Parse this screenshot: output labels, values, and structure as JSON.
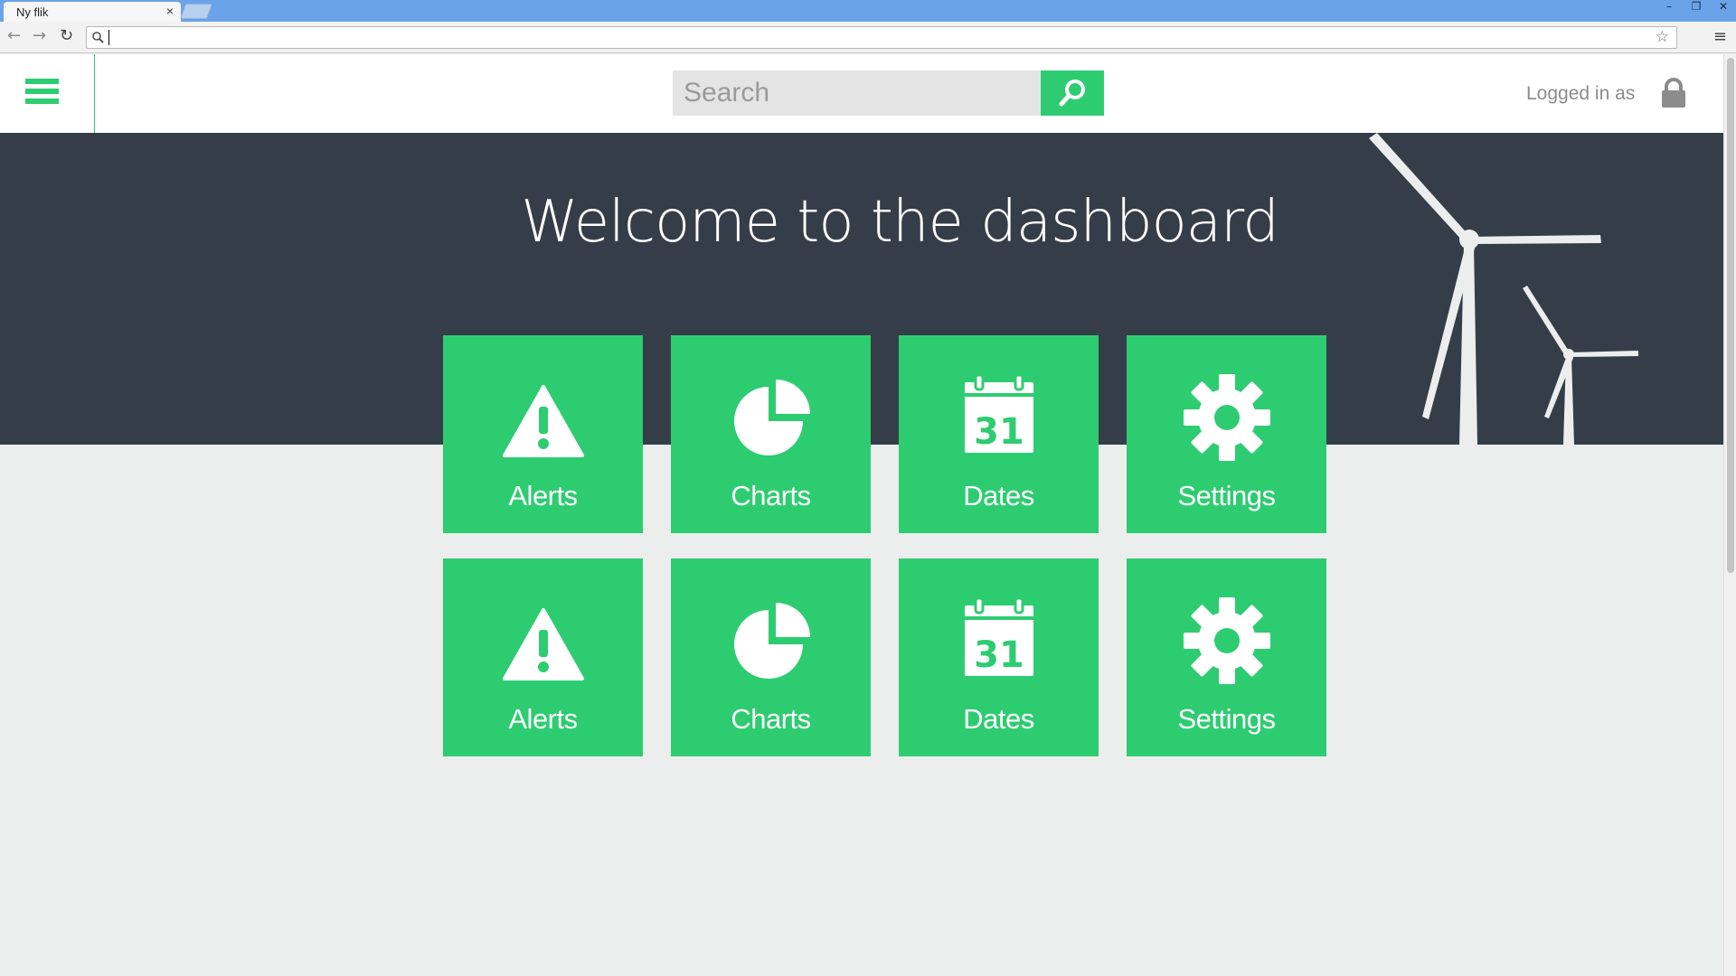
{
  "browser": {
    "tab_title": "Ny flik",
    "tab_close": "×",
    "window_controls": [
      "–",
      "❐",
      "✕"
    ],
    "address_value": ""
  },
  "header": {
    "search_placeholder": "Search",
    "logged_in_label": "Logged in as"
  },
  "hero": {
    "title": "Welcome to the dashboard"
  },
  "tiles": [
    {
      "label": "Alerts",
      "icon": "alert-icon"
    },
    {
      "label": "Charts",
      "icon": "pie-chart-icon"
    },
    {
      "label": "Dates",
      "icon": "calendar-icon"
    },
    {
      "label": "Settings",
      "icon": "gear-icon"
    },
    {
      "label": "Alerts",
      "icon": "alert-icon"
    },
    {
      "label": "Charts",
      "icon": "pie-chart-icon"
    },
    {
      "label": "Dates",
      "icon": "calendar-icon"
    },
    {
      "label": "Settings",
      "icon": "gear-icon"
    }
  ],
  "calendar_day": "31",
  "colors": {
    "accent": "#2ecc71",
    "hero_bg": "#353e48",
    "page_bg": "#eceeee"
  }
}
